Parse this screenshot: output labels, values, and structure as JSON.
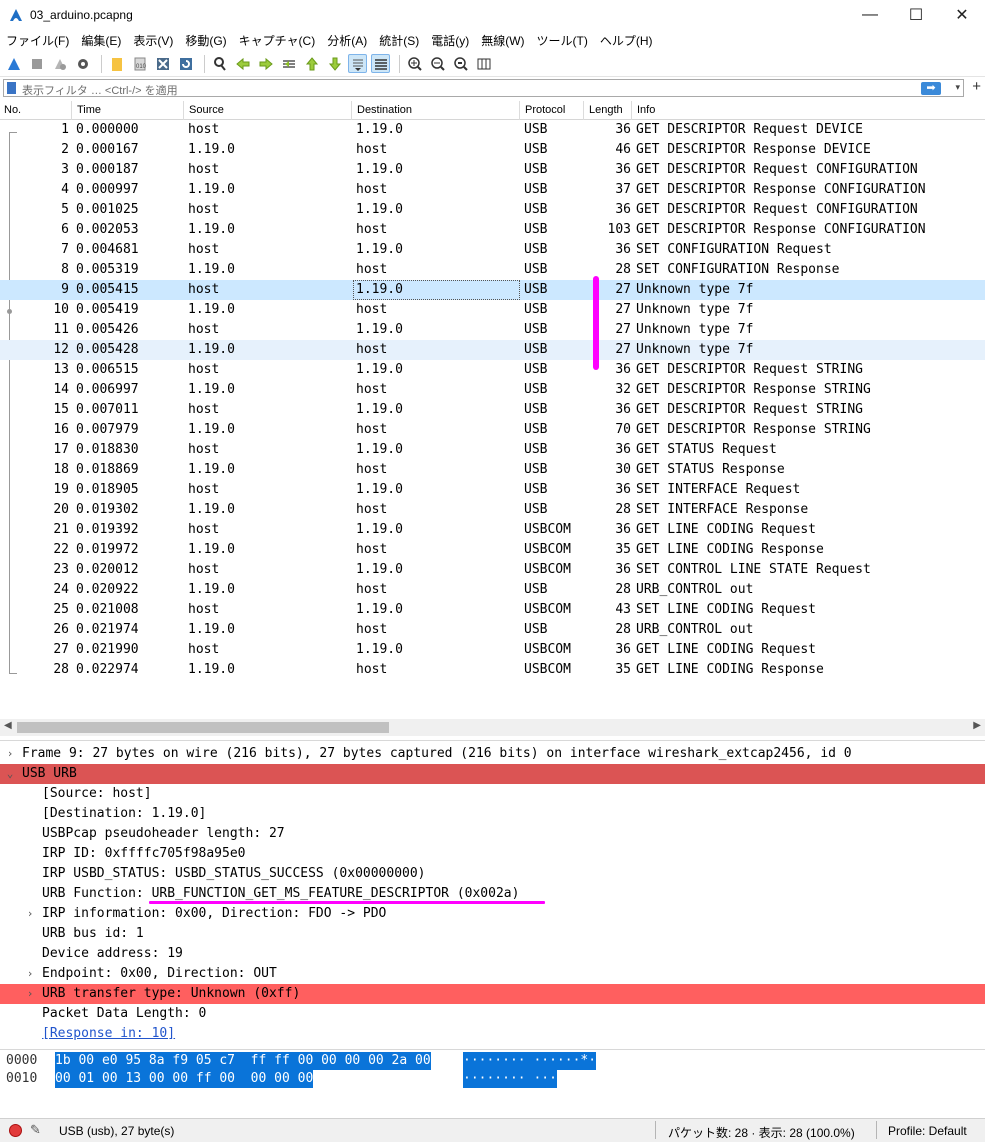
{
  "window": {
    "title": "03_arduino.pcapng",
    "minimize_glyph": "—",
    "maximize_glyph": "☐",
    "close_glyph": "✕"
  },
  "menu": [
    "ファイル(F)",
    "編集(E)",
    "表示(V)",
    "移動(G)",
    "キャプチャ(C)",
    "分析(A)",
    "統計(S)",
    "電話(y)",
    "無線(W)",
    "ツール(T)",
    "ヘルプ(H)"
  ],
  "toolbar": {
    "icons": [
      "shark-fin-start-icon",
      "stop-icon",
      "restart-icon",
      "options-gear-icon",
      "open-folder-icon",
      "save-file-icon",
      "close-file-icon",
      "reload-icon",
      "find-packet-icon",
      "go-back-icon",
      "go-forward-icon",
      "go-to-packet-icon",
      "first-packet-icon",
      "last-packet-icon",
      "auto-scroll-icon",
      "colorize-icon",
      "zoom-in-icon",
      "zoom-out-icon",
      "normal-size-icon",
      "resize-columns-icon"
    ]
  },
  "filter": {
    "placeholder": "表示フィルタ … <Ctrl-/> を適用",
    "apply_glyph": "➡",
    "dropdown_glyph": "▾",
    "add_glyph": "+"
  },
  "packet_list": {
    "columns": [
      "No.",
      "Time",
      "Source",
      "Destination",
      "Protocol",
      "Length",
      "Info"
    ],
    "rows": [
      {
        "no": "1",
        "time": "0.000000",
        "src": "host",
        "dst": "1.19.0",
        "proto": "USB",
        "len": "36",
        "info": "GET DESCRIPTOR Request DEVICE"
      },
      {
        "no": "2",
        "time": "0.000167",
        "src": "1.19.0",
        "dst": "host",
        "proto": "USB",
        "len": "46",
        "info": "GET DESCRIPTOR Response DEVICE"
      },
      {
        "no": "3",
        "time": "0.000187",
        "src": "host",
        "dst": "1.19.0",
        "proto": "USB",
        "len": "36",
        "info": "GET DESCRIPTOR Request CONFIGURATION"
      },
      {
        "no": "4",
        "time": "0.000997",
        "src": "1.19.0",
        "dst": "host",
        "proto": "USB",
        "len": "37",
        "info": "GET DESCRIPTOR Response CONFIGURATION"
      },
      {
        "no": "5",
        "time": "0.001025",
        "src": "host",
        "dst": "1.19.0",
        "proto": "USB",
        "len": "36",
        "info": "GET DESCRIPTOR Request CONFIGURATION"
      },
      {
        "no": "6",
        "time": "0.002053",
        "src": "1.19.0",
        "dst": "host",
        "proto": "USB",
        "len": "103",
        "info": "GET DESCRIPTOR Response CONFIGURATION"
      },
      {
        "no": "7",
        "time": "0.004681",
        "src": "host",
        "dst": "1.19.0",
        "proto": "USB",
        "len": "36",
        "info": "SET CONFIGURATION Request"
      },
      {
        "no": "8",
        "time": "0.005319",
        "src": "1.19.0",
        "dst": "host",
        "proto": "USB",
        "len": "28",
        "info": "SET CONFIGURATION Response"
      },
      {
        "no": "9",
        "time": "0.005415",
        "src": "host",
        "dst": "1.19.0",
        "proto": "USB",
        "len": "27",
        "info": "Unknown type 7f"
      },
      {
        "no": "10",
        "time": "0.005419",
        "src": "1.19.0",
        "dst": "host",
        "proto": "USB",
        "len": "27",
        "info": "Unknown type 7f"
      },
      {
        "no": "11",
        "time": "0.005426",
        "src": "host",
        "dst": "1.19.0",
        "proto": "USB",
        "len": "27",
        "info": "Unknown type 7f"
      },
      {
        "no": "12",
        "time": "0.005428",
        "src": "1.19.0",
        "dst": "host",
        "proto": "USB",
        "len": "27",
        "info": "Unknown type 7f"
      },
      {
        "no": "13",
        "time": "0.006515",
        "src": "host",
        "dst": "1.19.0",
        "proto": "USB",
        "len": "36",
        "info": "GET DESCRIPTOR Request STRING"
      },
      {
        "no": "14",
        "time": "0.006997",
        "src": "1.19.0",
        "dst": "host",
        "proto": "USB",
        "len": "32",
        "info": "GET DESCRIPTOR Response STRING"
      },
      {
        "no": "15",
        "time": "0.007011",
        "src": "host",
        "dst": "1.19.0",
        "proto": "USB",
        "len": "36",
        "info": "GET DESCRIPTOR Request STRING"
      },
      {
        "no": "16",
        "time": "0.007979",
        "src": "1.19.0",
        "dst": "host",
        "proto": "USB",
        "len": "70",
        "info": "GET DESCRIPTOR Response STRING"
      },
      {
        "no": "17",
        "time": "0.018830",
        "src": "host",
        "dst": "1.19.0",
        "proto": "USB",
        "len": "36",
        "info": "GET STATUS Request"
      },
      {
        "no": "18",
        "time": "0.018869",
        "src": "1.19.0",
        "dst": "host",
        "proto": "USB",
        "len": "30",
        "info": "GET STATUS Response"
      },
      {
        "no": "19",
        "time": "0.018905",
        "src": "host",
        "dst": "1.19.0",
        "proto": "USB",
        "len": "36",
        "info": "SET INTERFACE Request"
      },
      {
        "no": "20",
        "time": "0.019302",
        "src": "1.19.0",
        "dst": "host",
        "proto": "USB",
        "len": "28",
        "info": "SET INTERFACE Response"
      },
      {
        "no": "21",
        "time": "0.019392",
        "src": "host",
        "dst": "1.19.0",
        "proto": "USBCOM",
        "len": "36",
        "info": "GET LINE CODING Request"
      },
      {
        "no": "22",
        "time": "0.019972",
        "src": "1.19.0",
        "dst": "host",
        "proto": "USBCOM",
        "len": "35",
        "info": "GET LINE CODING Response"
      },
      {
        "no": "23",
        "time": "0.020012",
        "src": "host",
        "dst": "1.19.0",
        "proto": "USBCOM",
        "len": "36",
        "info": "SET CONTROL LINE STATE Request"
      },
      {
        "no": "24",
        "time": "0.020922",
        "src": "1.19.0",
        "dst": "host",
        "proto": "USB",
        "len": "28",
        "info": "URB_CONTROL out"
      },
      {
        "no": "25",
        "time": "0.021008",
        "src": "host",
        "dst": "1.19.0",
        "proto": "USBCOM",
        "len": "43",
        "info": "SET LINE CODING Request"
      },
      {
        "no": "26",
        "time": "0.021974",
        "src": "1.19.0",
        "dst": "host",
        "proto": "USB",
        "len": "28",
        "info": "URB_CONTROL out"
      },
      {
        "no": "27",
        "time": "0.021990",
        "src": "host",
        "dst": "1.19.0",
        "proto": "USBCOM",
        "len": "36",
        "info": "GET LINE CODING Request"
      },
      {
        "no": "28",
        "time": "0.022974",
        "src": "1.19.0",
        "dst": "host",
        "proto": "USBCOM",
        "len": "35",
        "info": "GET LINE CODING Response"
      }
    ]
  },
  "scrollbar": {
    "left_glyph": "◀",
    "right_glyph": "▶"
  },
  "details": {
    "rows": [
      {
        "exp": "›",
        "indent": 0,
        "text": "Frame 9: 27 bytes on wire (216 bits), 27 bytes captured (216 bits) on interface wireshark_extcap2456, id 0"
      },
      {
        "exp": "⌄",
        "indent": 0,
        "text": "USB URB",
        "hl": "hl1"
      },
      {
        "exp": "",
        "indent": 1,
        "text": "[Source: host]"
      },
      {
        "exp": "",
        "indent": 1,
        "text": "[Destination: 1.19.0]"
      },
      {
        "exp": "",
        "indent": 1,
        "text": "USBPcap pseudoheader length: 27"
      },
      {
        "exp": "",
        "indent": 1,
        "text": "IRP ID: 0xffffc705f98a95e0"
      },
      {
        "exp": "",
        "indent": 1,
        "text": "IRP USBD_STATUS: USBD_STATUS_SUCCESS (0x00000000)"
      },
      {
        "exp": "",
        "indent": 1,
        "text": "URB Function: URB_FUNCTION_GET_MS_FEATURE_DESCRIPTOR (0x002a)"
      },
      {
        "exp": "›",
        "indent": 1,
        "text": "IRP information: 0x00, Direction: FDO -> PDO"
      },
      {
        "exp": "",
        "indent": 1,
        "text": "URB bus id: 1"
      },
      {
        "exp": "",
        "indent": 1,
        "text": "Device address: 19"
      },
      {
        "exp": "›",
        "indent": 1,
        "text": "Endpoint: 0x00, Direction: OUT"
      },
      {
        "exp": "›",
        "indent": 1,
        "text": "URB transfer type: Unknown (0xff)",
        "hl": "hl2"
      },
      {
        "exp": "",
        "indent": 1,
        "text": "Packet Data Length: 0"
      },
      {
        "exp": "",
        "indent": 1,
        "text": "[Response in: 10]",
        "link": true
      }
    ]
  },
  "bytes": {
    "rows": [
      {
        "offset": "0000",
        "hex": "1b 00 e0 95 8a f9 05 c7  ff ff 00 00 00 00 2a 00",
        "ascii": "········ ······*·"
      },
      {
        "offset": "0010",
        "hex": "00 01 00 13 00 00 ff 00  00 00 00",
        "ascii": "········ ···"
      }
    ]
  },
  "status": {
    "note_glyph": "✎",
    "selected": "USB (usb), 27 byte(s)",
    "packets": "パケット数: 28 · 表示: 28 (100.0%)",
    "profile": "Profile: Default"
  },
  "colors": {
    "selected_row": "#cce8ff",
    "related_row": "#e6f1fc",
    "urb_header": "#db5454",
    "urb_transfer": "#ff5f5f",
    "annotation": "#ff00ff",
    "bytes_highlight": "#0a74d9"
  }
}
